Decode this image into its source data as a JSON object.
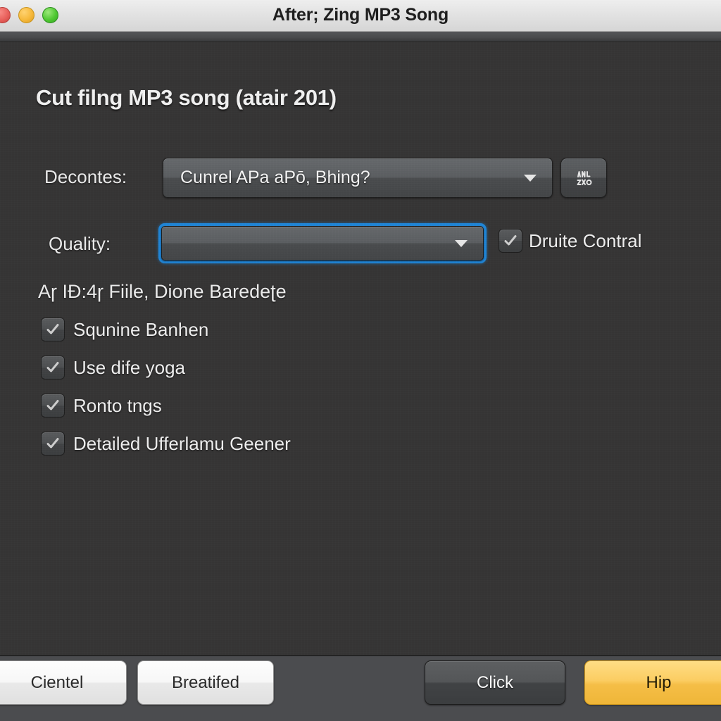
{
  "window": {
    "title": "After; Zing MP3 Song",
    "traffic_lights": [
      {
        "name": "close",
        "color": "#e8615c"
      },
      {
        "name": "minimize",
        "color": "#f6b93b"
      },
      {
        "name": "zoom",
        "color": "#4fc832"
      }
    ]
  },
  "content": {
    "heading": "Cut filng MP3 song (atair 201)",
    "decontes": {
      "label": "Decontes:",
      "selected": "Cunrel APa aPō, Bhing?",
      "icon_button_name": "edit-tags-icon"
    },
    "quality": {
      "label": "Quality:",
      "selected": "",
      "placeholder": "",
      "side_checkbox": {
        "label": "Druite Contral",
        "checked": true
      }
    },
    "section_header": "Aɼ IÐ:4ɼ Fiile, Dione Baredeʈe",
    "checkboxes": [
      {
        "label": "Squnine Banhen",
        "checked": true
      },
      {
        "label": "Use dife yoga",
        "checked": true
      },
      {
        "label": "Ronto tngs",
        "checked": true
      },
      {
        "label": "Detailed Ufferlamu Geener",
        "checked": true
      }
    ]
  },
  "footer": {
    "cancel_label": "Cientel",
    "secondary_label": "Breatifed",
    "click_label": "Click",
    "primary_label": "Hip"
  },
  "colors": {
    "accent_focus": "#1f86d8",
    "primary_button": "#f5be47",
    "body_background": "#353434",
    "footer_background": "#4b4c4f",
    "titlebar_background": "#e3e3e3"
  }
}
